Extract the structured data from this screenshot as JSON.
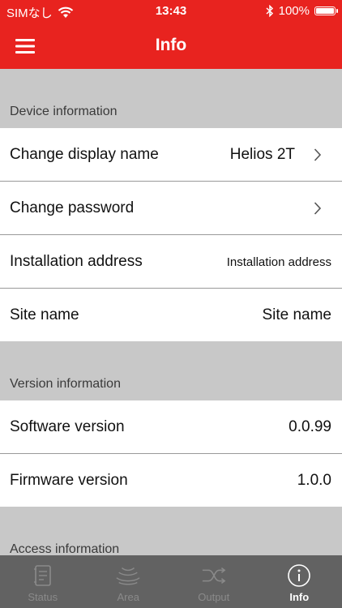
{
  "status_bar": {
    "carrier": "SIMなし",
    "time": "13:43",
    "battery": "100%"
  },
  "header": {
    "title": "Info",
    "menu_icon": "hamburger-menu-icon"
  },
  "sections": {
    "device": {
      "title": "Device information",
      "display_name": {
        "label": "Change display name",
        "value": "Helios 2T"
      },
      "password": {
        "label": "Change password"
      },
      "installation_address": {
        "label": "Installation address",
        "value": "Installation address"
      },
      "site_name": {
        "label": "Site name",
        "value": "Site name"
      }
    },
    "version": {
      "title": "Version information",
      "software": {
        "label": "Software version",
        "value": "0.0.99"
      },
      "firmware": {
        "label": "Firmware version",
        "value": "1.0.0"
      }
    },
    "access": {
      "title": "Access information"
    }
  },
  "tabs": [
    {
      "label": "Status",
      "icon": "document-icon",
      "active": false
    },
    {
      "label": "Area",
      "icon": "area-sensor-icon",
      "active": false
    },
    {
      "label": "Output",
      "icon": "shuffle-icon",
      "active": false
    },
    {
      "label": "Info",
      "icon": "info-icon",
      "active": true
    }
  ],
  "colors": {
    "brand_red": "#e8231f",
    "section_gray": "#c8c8c8",
    "tab_bar": "#5a5a5a"
  }
}
